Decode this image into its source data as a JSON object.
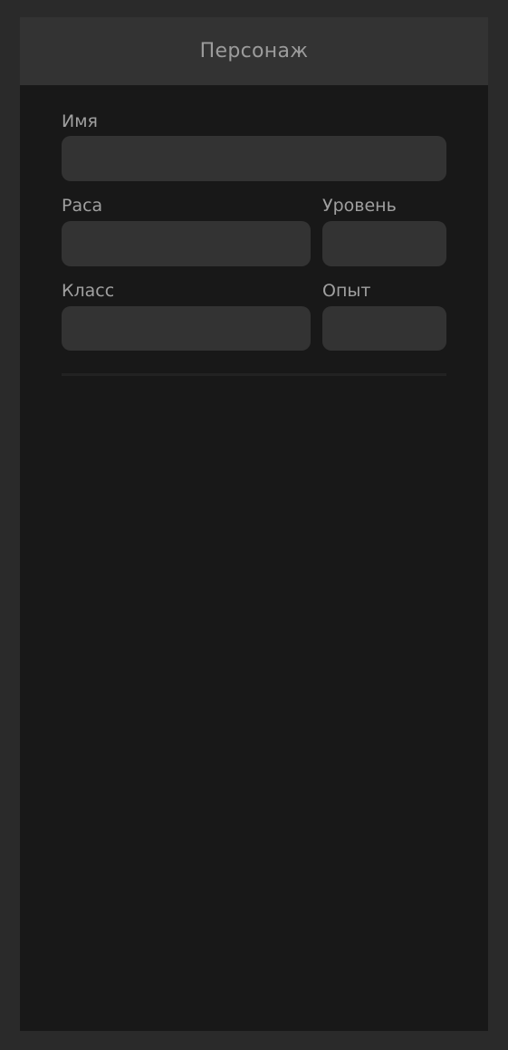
{
  "header": {
    "title": "Персонаж"
  },
  "form": {
    "name": {
      "label": "Имя",
      "value": ""
    },
    "race": {
      "label": "Раса",
      "value": ""
    },
    "level": {
      "label": "Уровень",
      "value": ""
    },
    "class": {
      "label": "Класс",
      "value": ""
    },
    "experience": {
      "label": "Опыт",
      "value": ""
    }
  },
  "colors": {
    "background": "#2a2a2a",
    "panel": "#181818",
    "header": "#333333",
    "field": "#333333",
    "label_text": "#a0a0a0"
  }
}
